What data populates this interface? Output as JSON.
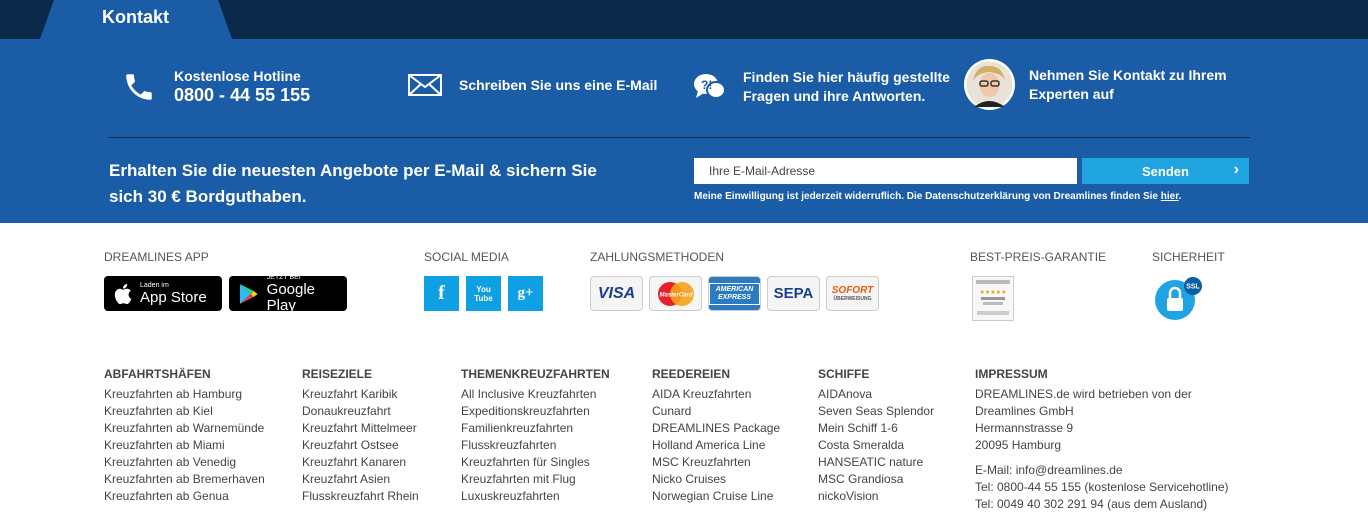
{
  "tab": {
    "label": "Kontakt"
  },
  "contact": {
    "hotline_label": "Kostenlose Hotline",
    "hotline_number": "0800 - 44 55 155",
    "email_text": "Schreiben Sie uns eine E-Mail",
    "faq_line1": "Finden Sie hier häufig gestellte",
    "faq_line2": "Fragen und ihre Antworten.",
    "expert_line1": "Nehmen Sie Kontakt zu Ihrem",
    "expert_line2": "Experten auf"
  },
  "newsletter": {
    "headline_line1": "Erhalten Sie die neuesten Angebote per E-Mail & sichern Sie",
    "headline_line2": "sich 30 € Bordguthaben.",
    "placeholder": "Ihre E-Mail-Adresse",
    "button": "Senden",
    "consent_text": "Meine Einwilligung ist jederzeit widerruflich. Die Datenschutzerklärung von Dreamlines finden Sie",
    "consent_link": "hier",
    "consent_end": "."
  },
  "sections": {
    "app": "DREAMLINES APP",
    "social": "SOCIAL MEDIA",
    "payment": "ZAHLUNGSMETHODEN",
    "price": "BEST-PREIS-GARANTIE",
    "security": "SICHERHEIT"
  },
  "apps": {
    "appstore_small": "Laden im",
    "appstore_big": "App Store",
    "googleplay_small": "JETZT BEI",
    "googleplay_big": "Google Play"
  },
  "social": {
    "facebook": "f",
    "youtube": "You Tube",
    "googleplus": "g+"
  },
  "payment": {
    "visa": "VISA",
    "mastercard": "MasterCard",
    "amex": "AMERICAN EXPRESS",
    "sepa": "SEPA",
    "sofort": "SOFORT",
    "sofort_sub": "ÜBERWEISUNG"
  },
  "security": {
    "ssl": "SSL"
  },
  "columns": [
    {
      "title": "ABFAHRTSHÄFEN",
      "items": [
        "Kreuzfahrten ab Hamburg",
        "Kreuzfahrten ab Kiel",
        "Kreuzfahrten ab Warnemünde",
        "Kreuzfahrten ab Miami",
        "Kreuzfahrten ab Venedig",
        "Kreuzfahrten ab Bremerhaven",
        "Kreuzfahrten ab Genua"
      ]
    },
    {
      "title": "REISEZIELE",
      "items": [
        "Kreuzfahrt Karibik",
        "Donaukreuzfahrt",
        "Kreuzfahrt Mittelmeer",
        "Kreuzfahrt Ostsee",
        "Kreuzfahrt Kanaren",
        "Kreuzfahrt Asien",
        "Flusskreuzfahrt Rhein"
      ]
    },
    {
      "title": "THEMENKREUZFAHRTEN",
      "items": [
        "All Inclusive Kreuzfahrten",
        "Expeditionskreuzfahrten",
        "Familienkreuzfahrten",
        "Flusskreuzfahrten",
        "Kreuzfahrten für Singles",
        "Kreuzfahrten mit Flug",
        "Luxuskreuzfahrten"
      ]
    },
    {
      "title": "REEDEREIEN",
      "items": [
        "AIDA Kreuzfahrten",
        "Cunard",
        "DREAMLINES Package",
        "Holland America Line",
        "MSC Kreuzfahrten",
        "Nicko Cruises",
        "Norwegian Cruise Line"
      ]
    },
    {
      "title": "SCHIFFE",
      "items": [
        "AIDAnova",
        "Seven Seas Splendor",
        "Mein Schiff 1-6",
        "Costa Smeralda",
        "HANSEATIC nature",
        "MSC Grandiosa",
        "nickoVision"
      ]
    }
  ],
  "impressum": {
    "title": "IMPRESSUM",
    "line1": "DREAMLINES.de wird betrieben von der",
    "line2": "Dreamlines GmbH",
    "line3": "Hermannstrasse 9",
    "line4": "20095 Hamburg",
    "email_label": "E-Mail:",
    "email": "info@dreamlines.de",
    "tel": "Tel: 0800-44 55 155 (kostenlose Servicehotline)",
    "tel2": "Tel: 0049 40 302 291 94 (aus dem Ausland)"
  },
  "colors": {
    "topbar": "#0b2a4a",
    "primary": "#1a5ca6",
    "accent": "#20a4e0"
  }
}
